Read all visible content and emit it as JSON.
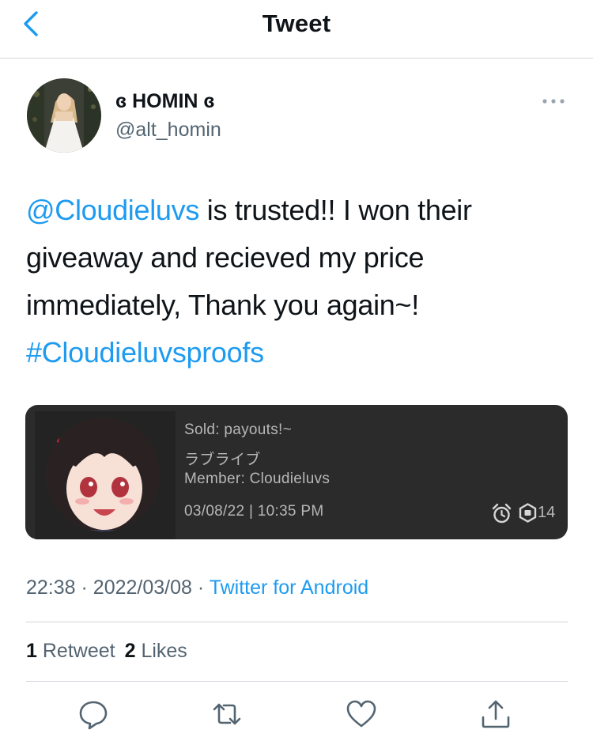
{
  "header": {
    "title": "Tweet",
    "back_icon": "chevron-left-icon",
    "accent_color": "#1d9bf0"
  },
  "author": {
    "display_name": "ɞ HOMIN ɞ",
    "handle": "@alt_homin"
  },
  "tweet": {
    "lines": [
      [
        {
          "text": "@Cloudieluvs",
          "type": "mention"
        },
        {
          "text": " is trusted!! I won their",
          "type": "text"
        }
      ],
      [
        {
          "text": "giveaway and recieved my price",
          "type": "text"
        }
      ],
      [
        {
          "text": "immediately, Thank you again~!",
          "type": "text"
        }
      ],
      [
        {
          "text": "#Cloudieluvsproofs",
          "type": "hashtag"
        }
      ]
    ]
  },
  "media": {
    "line1": "Sold: payouts!~",
    "line2": "ラブライブ",
    "line3": "Member: Cloudieluvs",
    "datetime": "03/08/22 | 10:35 PM",
    "icons": [
      "alarm-clock-icon",
      "robux-icon"
    ],
    "robux_amount": "14",
    "background_color": "#2b2b2b"
  },
  "meta": {
    "time": "22:38",
    "separator": "·",
    "date": "2022/03/08",
    "source": "Twitter for Android"
  },
  "stats": {
    "retweet_count": "1",
    "retweet_label": "Retweet",
    "like_count": "2",
    "like_label": "Likes"
  },
  "actions": [
    "reply-icon",
    "retweet-icon",
    "like-icon",
    "share-icon"
  ]
}
